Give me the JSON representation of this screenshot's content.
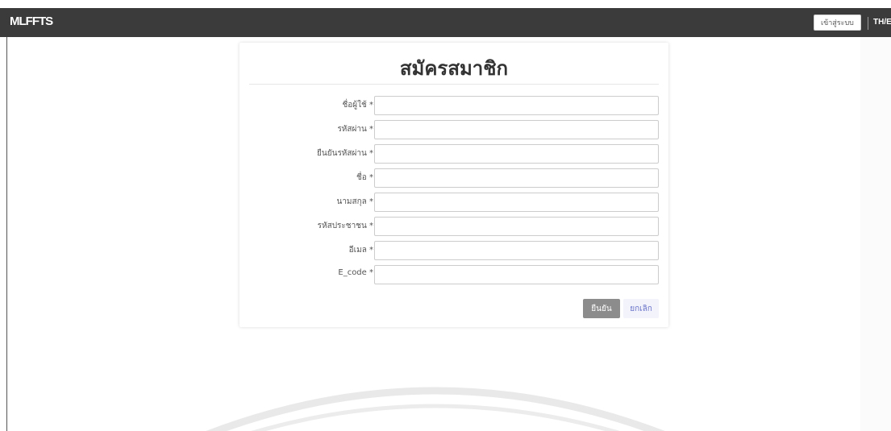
{
  "navbar": {
    "brand": "MLFFTS",
    "login_label": "เข้าสู่ระบบ",
    "language_label": "TH/EN",
    "background_color": "#3b3b3b"
  },
  "form": {
    "title": "สมัครสมาชิก",
    "fields": [
      {
        "label": "ชื่อผู้ใช้ *",
        "value": ""
      },
      {
        "label": "รหัสผ่าน *",
        "value": ""
      },
      {
        "label": "ยืนยันรหัสผ่าน *",
        "value": ""
      },
      {
        "label": "ชื่อ *",
        "value": ""
      },
      {
        "label": "นามสกุล *",
        "value": ""
      },
      {
        "label": "รหัสประชาชน *",
        "value": ""
      },
      {
        "label": "อีเมล *",
        "value": ""
      },
      {
        "label": "E_code *",
        "value": ""
      }
    ],
    "confirm_label": "ยืนยัน",
    "cancel_label": "ยกเลิก"
  },
  "colors": {
    "confirm_button": "#8c8c8c",
    "cancel_text": "#6a74c9"
  }
}
